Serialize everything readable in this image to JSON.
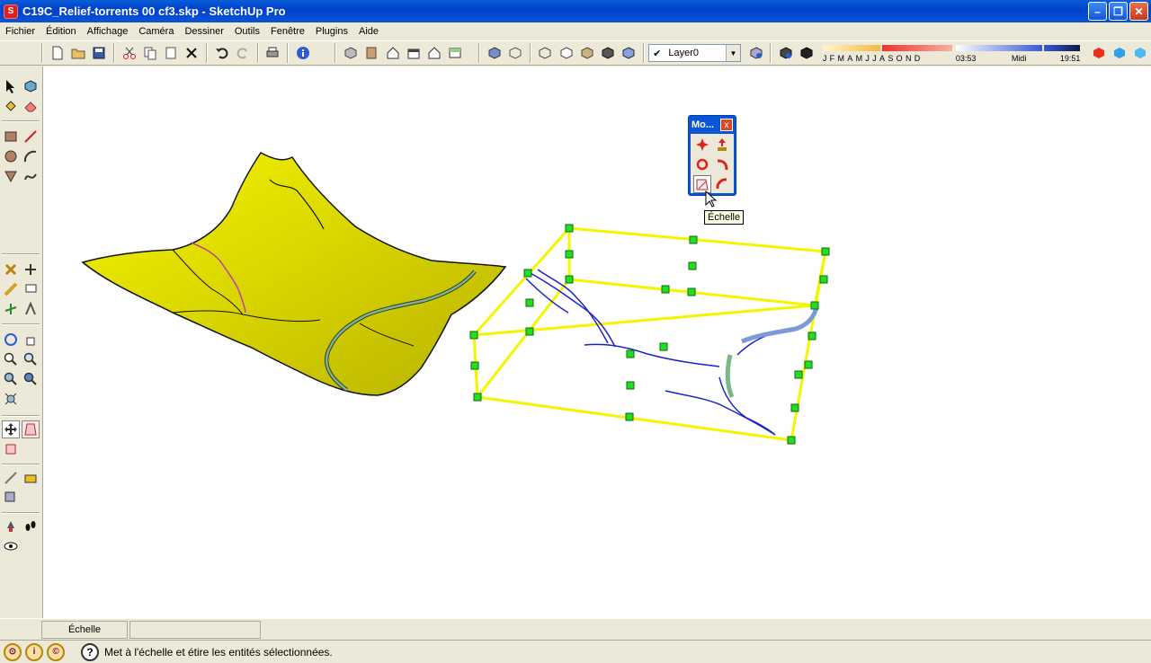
{
  "window": {
    "title": "C19C_Relief-torrents 00 cf3.skp - SketchUp Pro",
    "minimize": "–",
    "restore": "❐",
    "close": "✕"
  },
  "menu": [
    "Fichier",
    "Édition",
    "Affichage",
    "Caméra",
    "Dessiner",
    "Outils",
    "Fenêtre",
    "Plugins",
    "Aide"
  ],
  "layers": {
    "check": "✔",
    "current": "Layer0"
  },
  "shadows": {
    "months": [
      "J",
      "F",
      "M",
      "A",
      "M",
      "J",
      "J",
      "A",
      "S",
      "O",
      "N",
      "D"
    ],
    "time_start": "03:53",
    "time_mid": "Midi",
    "time_end": "19:51"
  },
  "move_palette": {
    "title": "Mo...",
    "close": "x"
  },
  "tooltip": "Échelle",
  "measurements": {
    "label": "Échelle",
    "value": ""
  },
  "status": {
    "help": "?",
    "text": "Met à l'échelle et étire les entités sélectionnées."
  },
  "colors": {
    "terrain": "#e8e80a",
    "bbox": "#f5f500",
    "grip": "#22dd22",
    "river": "#1a22c8",
    "title_blue": "#0a54d8"
  }
}
